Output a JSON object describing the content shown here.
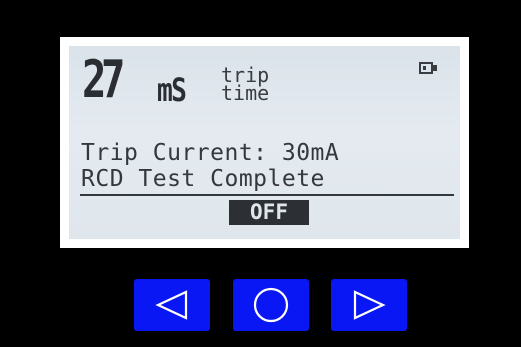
{
  "display": {
    "measurement": {
      "value": "27",
      "unit": "mS",
      "label_line_1": "trip",
      "label_line_2": "time"
    },
    "status_lines": [
      "Trip Current: 30mA",
      "RCD Test Complete"
    ],
    "softkey_label": "OFF",
    "battery_icon": "battery-icon"
  },
  "keypad": {
    "left_icon": "triangle-left-icon",
    "center_icon": "circle-icon",
    "right_icon": "triangle-right-icon"
  },
  "colors": {
    "bezel": "#000000",
    "lcd_background": "#dfe6ec",
    "lcd_text": "#2c2f33",
    "key_blue": "#0a17f5"
  }
}
